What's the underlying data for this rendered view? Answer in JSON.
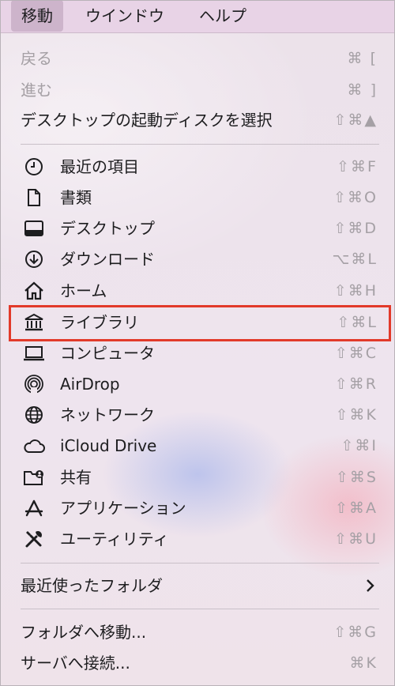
{
  "menubar": {
    "items": [
      "移動",
      "ウインドウ",
      "ヘルプ"
    ]
  },
  "menu": {
    "top": [
      {
        "label": "戻る",
        "shortcut": "⌘ [",
        "enabled": false
      },
      {
        "label": "進む",
        "shortcut": "⌘ ]",
        "enabled": false
      },
      {
        "label": "デスクトップの起動ディスクを選択",
        "shortcut": "⇧⌘▲",
        "enabled": true
      }
    ],
    "places": [
      {
        "icon": "clock-icon",
        "label": "最近の項目",
        "shortcut": "⇧⌘F"
      },
      {
        "icon": "document-icon",
        "label": "書類",
        "shortcut": "⇧⌘O"
      },
      {
        "icon": "desktop-icon",
        "label": "デスクトップ",
        "shortcut": "⇧⌘D"
      },
      {
        "icon": "download-icon",
        "label": "ダウンロード",
        "shortcut": "⌥⌘L"
      },
      {
        "icon": "home-icon",
        "label": "ホーム",
        "shortcut": "⇧⌘H"
      },
      {
        "icon": "library-icon",
        "label": "ライブラリ",
        "shortcut": "⇧⌘L"
      },
      {
        "icon": "laptop-icon",
        "label": "コンピュータ",
        "shortcut": "⇧⌘C"
      },
      {
        "icon": "airdrop-icon",
        "label": "AirDrop",
        "shortcut": "⇧⌘R"
      },
      {
        "icon": "globe-icon",
        "label": "ネットワーク",
        "shortcut": "⇧⌘K"
      },
      {
        "icon": "icloud-icon",
        "label": "iCloud Drive",
        "shortcut": "⇧⌘I"
      },
      {
        "icon": "shared-folder-icon",
        "label": "共有",
        "shortcut": "⇧⌘S"
      },
      {
        "icon": "applications-icon",
        "label": "アプリケーション",
        "shortcut": "⇧⌘A"
      },
      {
        "icon": "utilities-icon",
        "label": "ユーティリティ",
        "shortcut": "⇧⌘U"
      }
    ],
    "recent_folders": {
      "label": "最近使ったフォルダ"
    },
    "bottom": [
      {
        "label": "フォルダへ移動...",
        "shortcut": "⇧⌘G"
      },
      {
        "label": "サーバへ接続...",
        "shortcut": "⌘K"
      }
    ]
  },
  "highlight_color": "#e23a2a"
}
